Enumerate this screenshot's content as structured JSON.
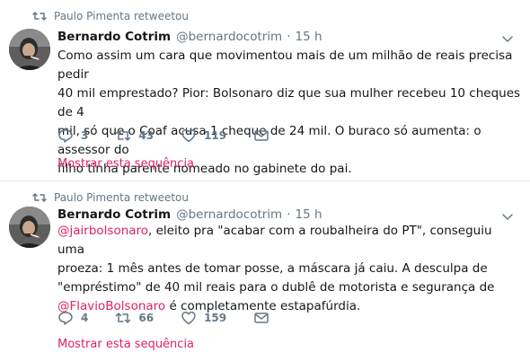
{
  "tweets": [
    {
      "retweeted_by": "Paulo Pimenta retweetou",
      "name": "Bernardo Cotrim",
      "handle": "@bernardocotrim",
      "separator": "·",
      "time": "15 h",
      "text_lines": [
        "Como assim um cara que movimentou mais de um milhão de reais precisa pedir",
        "40 mil emprestado? Pior: Bolsonaro diz que sua mulher recebeu 10 cheques de 4",
        "mil, só que o Coaf acusa 1 cheque de 24 mil. O buraco só aumenta: o assessor do",
        "filho tinha parente nomeado no gabinete do pai."
      ],
      "replies": "3",
      "retweets": "43",
      "likes": "119",
      "show_thread": "Mostrar esta sequência"
    },
    {
      "retweeted_by": "Paulo Pimenta retweetou",
      "name": "Bernardo Cotrim",
      "handle": "@bernardocotrim",
      "separator": "·",
      "time": "15 h",
      "line1_mention": "@jairbolsonaro",
      "line1_rest": ", eleito pra \"acabar com a roubalheira do PT\", conseguiu uma",
      "line2": "proeza: 1 mês antes de tomar posse, a máscara já caiu. A desculpa de",
      "line3": "\"empréstimo\" de 40 mil reais para o dublê de motorista e segurança de",
      "line4_mention": "@FlavioBolsonaro",
      "line4_rest": " é completamente estapafúrdia.",
      "replies": "4",
      "retweets": "66",
      "likes": "159",
      "show_thread": "Mostrar esta sequência"
    }
  ],
  "colors": {
    "text": "#14171a",
    "secondary": "#657786",
    "link": "#e0245e",
    "divider": "#e6ecf0"
  }
}
